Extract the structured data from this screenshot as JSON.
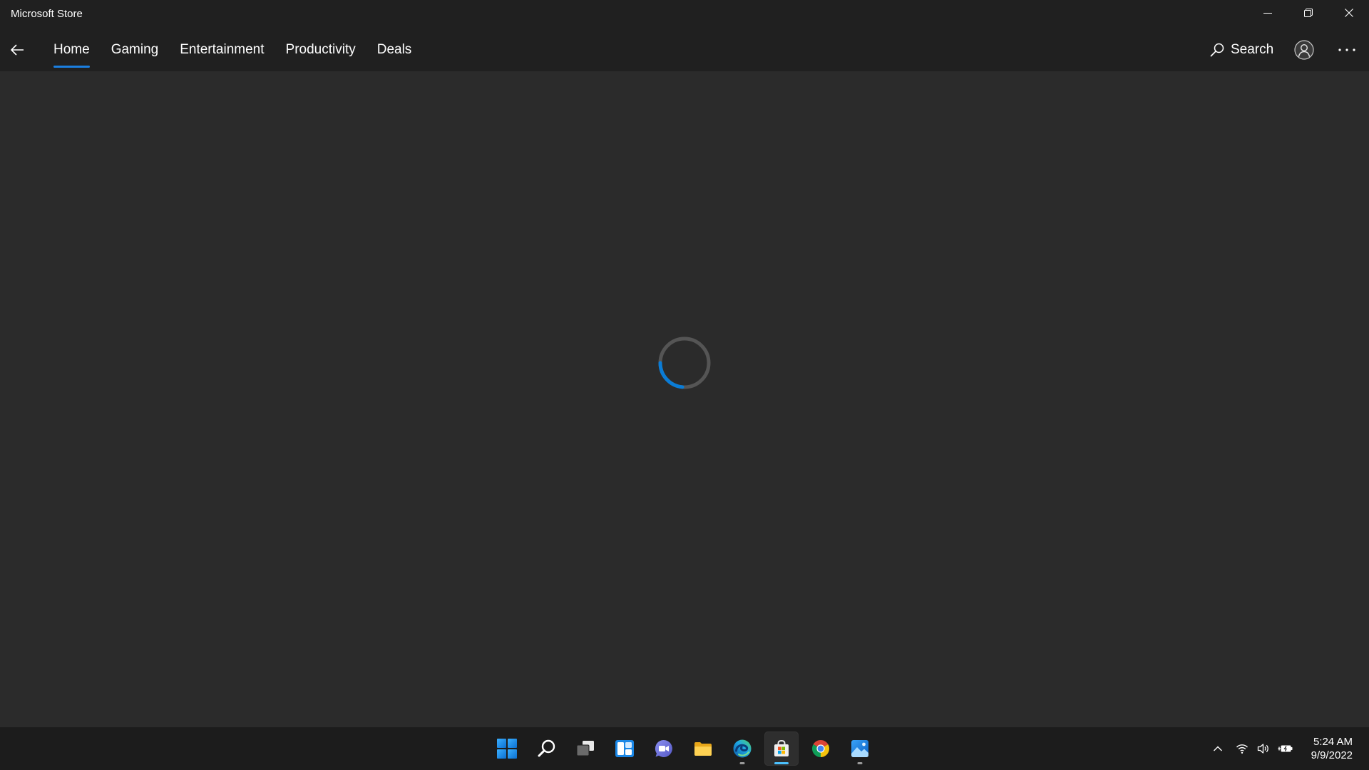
{
  "window": {
    "title": "Microsoft Store",
    "controls": {
      "minimize_icon": "minimize-icon",
      "restore_icon": "restore-icon",
      "close_icon": "close-icon"
    }
  },
  "nav": {
    "back_icon": "back-arrow-icon",
    "tabs": [
      {
        "label": "Home",
        "active": true
      },
      {
        "label": "Gaming",
        "active": false
      },
      {
        "label": "Entertainment",
        "active": false
      },
      {
        "label": "Productivity",
        "active": false
      },
      {
        "label": "Deals",
        "active": false
      }
    ],
    "search": {
      "icon": "search-icon",
      "label": "Search"
    },
    "account_icon": "account-icon",
    "more_icon": "more-icon"
  },
  "content": {
    "spinner_track_color": "#555555",
    "spinner_arc_color": "#0a7cd6"
  },
  "taskbar": {
    "apps": [
      {
        "icon": "start-icon",
        "running": false,
        "active": false
      },
      {
        "icon": "search-icon",
        "running": false,
        "active": false
      },
      {
        "icon": "task-view-icon",
        "running": false,
        "active": false
      },
      {
        "icon": "widgets-icon",
        "running": false,
        "active": false
      },
      {
        "icon": "chat-icon",
        "running": false,
        "active": false
      },
      {
        "icon": "file-explorer-icon",
        "running": false,
        "active": false
      },
      {
        "icon": "edge-icon",
        "running": true,
        "active": false
      },
      {
        "icon": "store-icon",
        "running": true,
        "active": true
      },
      {
        "icon": "chrome-icon",
        "running": false,
        "active": false
      },
      {
        "icon": "photos-icon",
        "running": true,
        "active": false
      }
    ],
    "tray_icons": [
      "chevron-up-icon",
      "wifi-icon",
      "volume-icon",
      "battery-charging-icon"
    ],
    "clock": {
      "time": "5:24 AM",
      "date": "9/9/2022"
    }
  },
  "colors": {
    "accent": "#1b7fe0",
    "active_indicator": "#4cc2ff",
    "background": "#2b2b2b",
    "header": "#202020",
    "taskbar": "#1c1c1c"
  }
}
